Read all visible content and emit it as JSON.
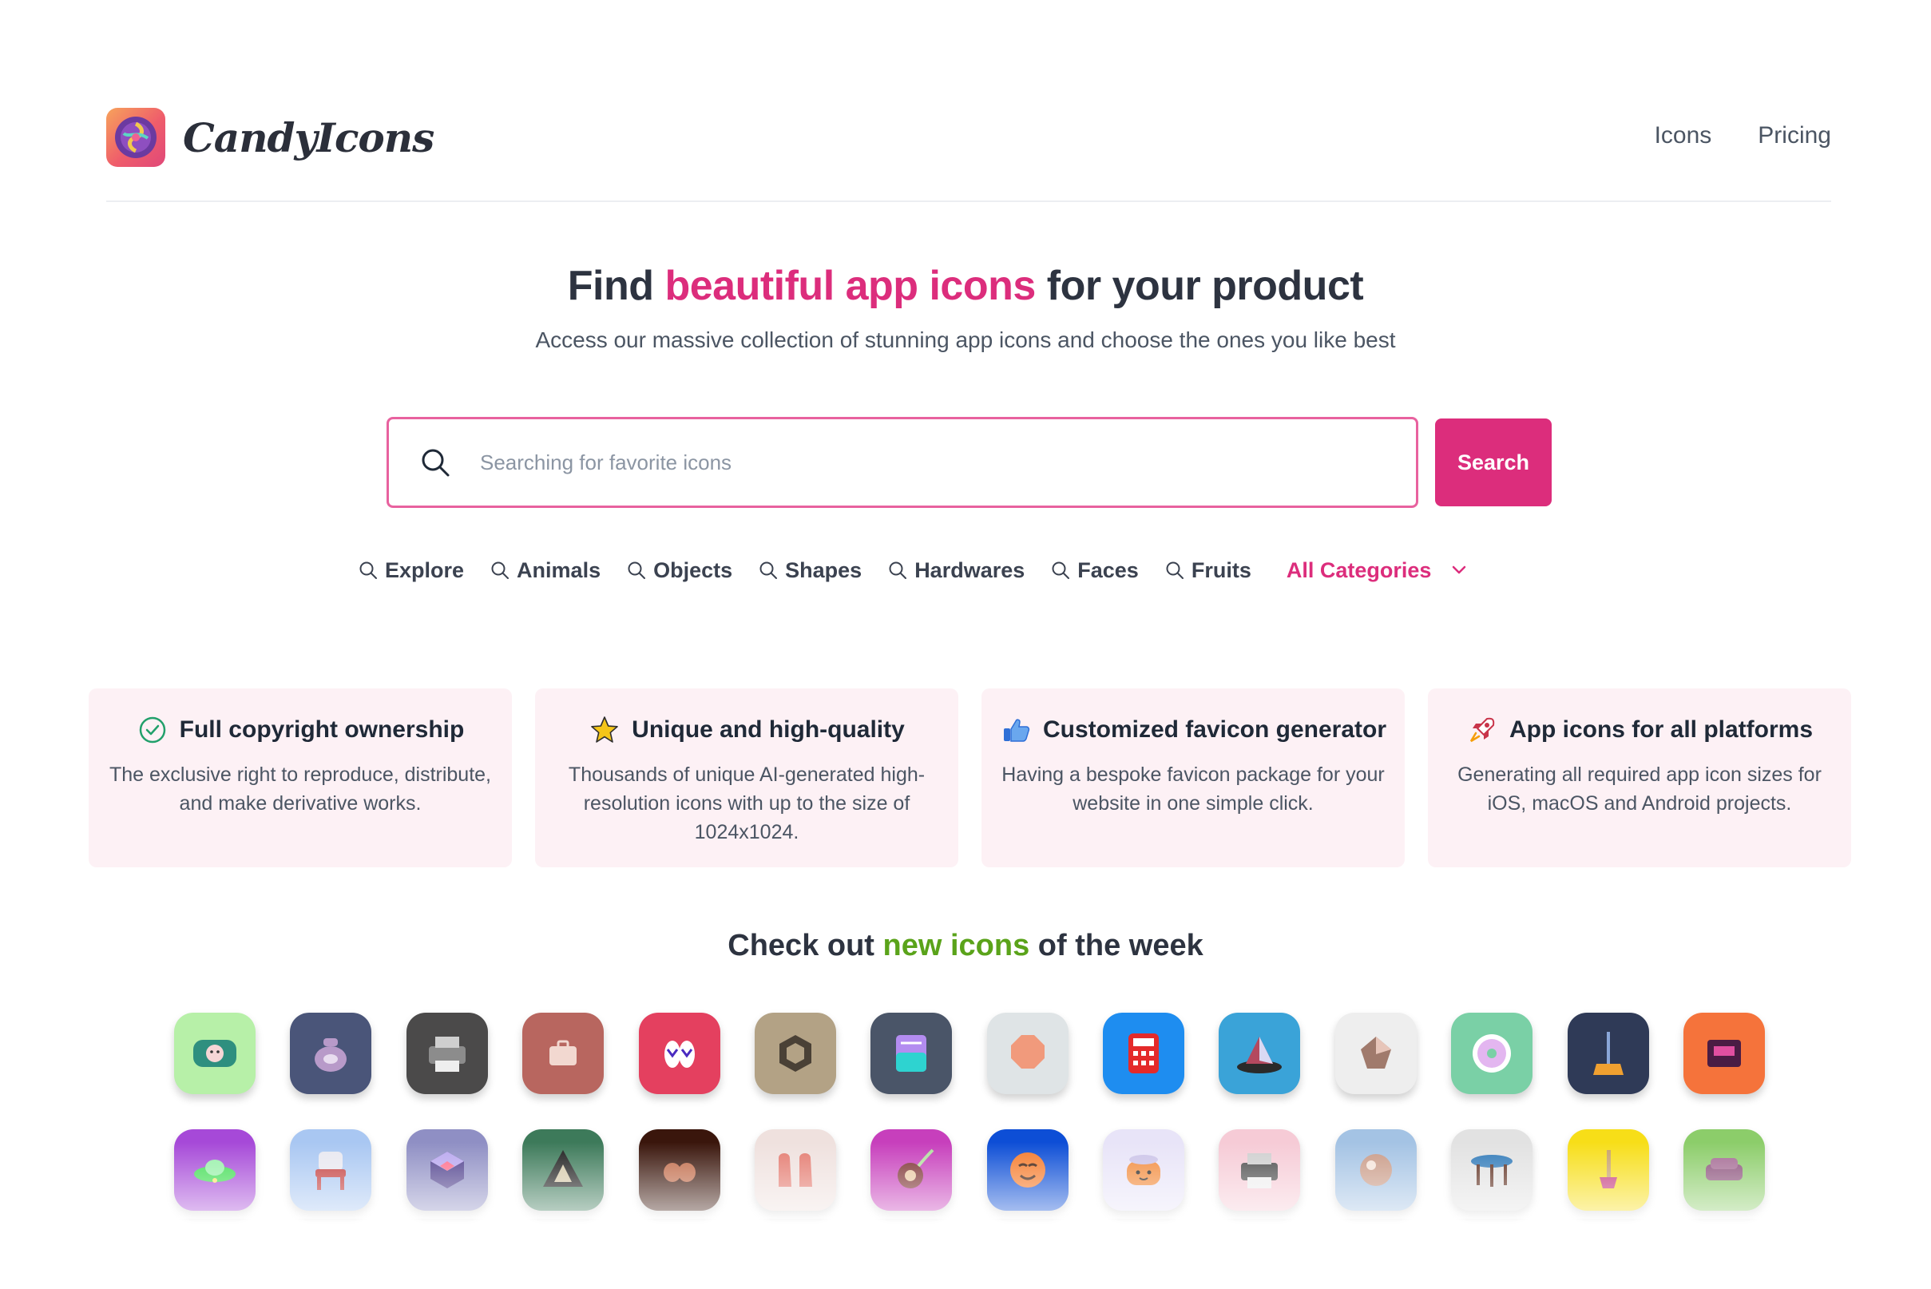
{
  "brand": {
    "name": "CandyIcons"
  },
  "nav": {
    "icons_label": "Icons",
    "pricing_label": "Pricing"
  },
  "hero": {
    "title_pre": "Find ",
    "title_highlight": "beautiful app icons",
    "title_post": " for your product",
    "subtitle": "Access our massive collection of stunning app icons and choose the ones you like best",
    "highlight_color": "#dc2d7c"
  },
  "search": {
    "placeholder": "Searching for favorite icons",
    "value": "",
    "button_label": "Search",
    "button_color": "#dc2d7c"
  },
  "categories": [
    "Explore",
    "Animals",
    "Objects",
    "Shapes",
    "Hardwares",
    "Faces",
    "Fruits"
  ],
  "all_categories_label": "All Categories",
  "features": [
    {
      "icon": "check-circle-icon",
      "title": "Full copyright ownership",
      "description": "The exclusive right to reproduce, distribute, and make derivative works."
    },
    {
      "icon": "star-icon",
      "title": "Unique and high-quality",
      "description": "Thousands of unique AI-generated high-resolution icons with up to the size of 1024x1024."
    },
    {
      "icon": "thumbs-up-icon",
      "title": "Customized favicon generator",
      "description": "Having a bespoke favicon package for your website in one simple click."
    },
    {
      "icon": "rocket-icon",
      "title": "App icons for all platforms",
      "description": "Generating all required app icon sizes for iOS, macOS and Android projects."
    }
  ],
  "week": {
    "title_pre": "Check out ",
    "title_highlight": "new icons",
    "title_post": " of the week",
    "highlight_color": "#5aa31a"
  },
  "icon_rows": [
    [
      {
        "name": "pillow-face-icon",
        "bg": "#b7f0a8",
        "fg": "#2e8f7f",
        "shape": "pillow"
      },
      {
        "name": "teapot-icon",
        "bg": "#4a5579",
        "fg": "#b89ac9",
        "shape": "pot"
      },
      {
        "name": "printer-icon",
        "bg": "#4b4a4a",
        "fg": "#8c8c8c",
        "shape": "printer"
      },
      {
        "name": "briefcase-icon",
        "bg": "#b8665f",
        "fg": "#f2d8d0",
        "shape": "case"
      },
      {
        "name": "flip-flops-icon",
        "bg": "#e4405f",
        "fg": "#ffffff",
        "shape": "sandals"
      },
      {
        "name": "hex-nut-icon",
        "bg": "#b3a285",
        "fg": "#4a4136",
        "shape": "hex"
      },
      {
        "name": "notebook-icon",
        "bg": "#4a5568",
        "fg": "#b38cf0",
        "shape": "book"
      },
      {
        "name": "octagon-gem-icon",
        "bg": "#dfe4e6",
        "fg": "#f19a7c",
        "shape": "octagon"
      },
      {
        "name": "calculator-icon",
        "bg": "#1e8df0",
        "fg": "#e42a2a",
        "shape": "calc"
      },
      {
        "name": "glass-pyramid-icon",
        "bg": "#3aa3d8",
        "fg": "#b4495f",
        "shape": "pyramid"
      },
      {
        "name": "wood-gem-icon",
        "bg": "#eeeeee",
        "fg": "#a07a6c",
        "shape": "gem"
      },
      {
        "name": "cd-disc-icon",
        "bg": "#7ad0a6",
        "fg": "#ffffff",
        "shape": "disc"
      },
      {
        "name": "mop-icon",
        "bg": "#2f3a57",
        "fg": "#f0a030",
        "shape": "mop"
      },
      {
        "name": "coffee-machine-icon",
        "bg": "#f5733b",
        "fg": "#4a1c44",
        "shape": "machine"
      }
    ],
    [
      {
        "name": "ufo-icon",
        "bg": "#a649d8",
        "fg": "#3ddc50",
        "shape": "ufo"
      },
      {
        "name": "chair-icon",
        "bg": "#a9c7f2",
        "fg": "#c23a3a",
        "shape": "chair"
      },
      {
        "name": "cube-icon",
        "bg": "#8f8fc4",
        "fg": "#4e3f8c",
        "shape": "cube"
      },
      {
        "name": "triangle-icon",
        "bg": "#3d7a5a",
        "fg": "#1d1d1d",
        "shape": "triangle"
      },
      {
        "name": "mittens-icon",
        "bg": "#3a160c",
        "fg": "#c06a48",
        "shape": "mittens"
      },
      {
        "name": "oven-mitts-icon",
        "bg": "#efe1de",
        "fg": "#e47b70",
        "shape": "mitts"
      },
      {
        "name": "vacuum-icon",
        "bg": "#c73fbc",
        "fg": "#7a2f2f",
        "shape": "vacuum"
      },
      {
        "name": "monk-face-icon",
        "bg": "#0d4ed6",
        "fg": "#f57a2a",
        "shape": "face"
      },
      {
        "name": "pot-face-icon",
        "bg": "#e8e4f8",
        "fg": "#f28a3a",
        "shape": "potface"
      },
      {
        "name": "photo-printer-icon",
        "bg": "#f6cbd6",
        "fg": "#4a4a4a",
        "shape": "printer"
      },
      {
        "name": "sphere-icon",
        "bg": "#a4c3e4",
        "fg": "#c99a86",
        "shape": "sphere"
      },
      {
        "name": "round-table-icon",
        "bg": "#e2e2e2",
        "fg": "#2f79b8",
        "shape": "table"
      },
      {
        "name": "plunger-icon",
        "bg": "#f7de18",
        "fg": "#c2357a",
        "shape": "plunger"
      },
      {
        "name": "sofa-icon",
        "bg": "#8ccd6a",
        "fg": "#8a4f7a",
        "shape": "sofa"
      }
    ]
  ]
}
